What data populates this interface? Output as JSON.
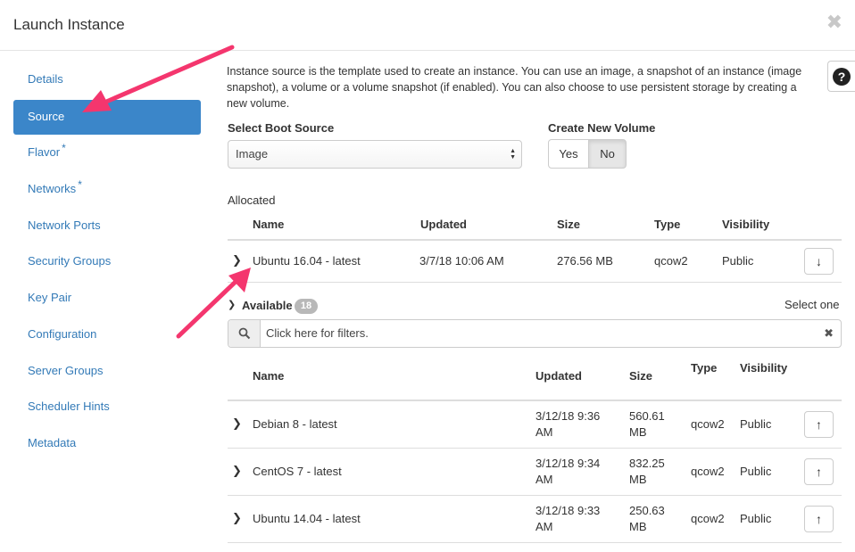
{
  "modal": {
    "title": "Launch Instance",
    "close_glyph": "✖",
    "help_glyph": "?"
  },
  "sidebar": {
    "items": [
      {
        "label": "Details",
        "required": false
      },
      {
        "label": "Source",
        "required": false,
        "active": true
      },
      {
        "label": "Flavor",
        "required": true
      },
      {
        "label": "Networks",
        "required": true
      },
      {
        "label": "Network Ports",
        "required": false
      },
      {
        "label": "Security Groups",
        "required": false
      },
      {
        "label": "Key Pair",
        "required": false
      },
      {
        "label": "Configuration",
        "required": false
      },
      {
        "label": "Server Groups",
        "required": false
      },
      {
        "label": "Scheduler Hints",
        "required": false
      },
      {
        "label": "Metadata",
        "required": false
      }
    ],
    "required_mark": "*"
  },
  "main": {
    "description": "Instance source is the template used to create an instance. You can use an image, a snapshot of an instance (image snapshot), a volume or a volume snapshot (if enabled). You can also choose to use persistent storage by creating a new volume.",
    "boot_source_label": "Select Boot Source",
    "boot_source_value": "Image",
    "create_volume_label": "Create New Volume",
    "create_volume_yes": "Yes",
    "create_volume_no": "No",
    "create_volume_selected": "No"
  },
  "allocated": {
    "label": "Allocated",
    "columns": [
      "Name",
      "Updated",
      "Size",
      "Type",
      "Visibility"
    ],
    "rows": [
      {
        "name": "Ubuntu 16.04 - latest",
        "updated": "3/7/18 10:06 AM",
        "size": "276.56 MB",
        "type": "qcow2",
        "visibility": "Public"
      }
    ]
  },
  "available": {
    "label": "Available",
    "count": "18",
    "select_hint": "Select one",
    "filter_placeholder": "Click here for filters.",
    "columns": [
      "Name",
      "Updated",
      "Size",
      "Type",
      "Visibility"
    ],
    "rows": [
      {
        "name": "Debian 8 - latest",
        "updated_1": "3/12/18 9:36",
        "updated_2": "AM",
        "size_1": "560.61",
        "size_2": "MB",
        "type": "qcow2",
        "visibility": "Public"
      },
      {
        "name": "CentOS 7 - latest",
        "updated_1": "3/12/18 9:34",
        "updated_2": "AM",
        "size_1": "832.25",
        "size_2": "MB",
        "type": "qcow2",
        "visibility": "Public"
      },
      {
        "name": "Ubuntu 14.04 - latest",
        "updated_1": "3/12/18 9:33",
        "updated_2": "AM",
        "size_1": "250.63",
        "size_2": "MB",
        "type": "qcow2",
        "visibility": "Public"
      }
    ]
  },
  "icons": {
    "close": "close-icon",
    "help": "question-circle-icon",
    "expand": "chevron-right-icon",
    "collapse": "chevron-down-icon",
    "search": "search-icon",
    "clear": "times-icon",
    "deallocate": "arrow-down-icon",
    "allocate": "arrow-up-icon",
    "annotation": "arrow-annotation"
  },
  "colors": {
    "accent": "#3b86c9",
    "link": "#337ab7",
    "annotation_arrow": "#f4366e",
    "badge": "#b8b8b8"
  }
}
